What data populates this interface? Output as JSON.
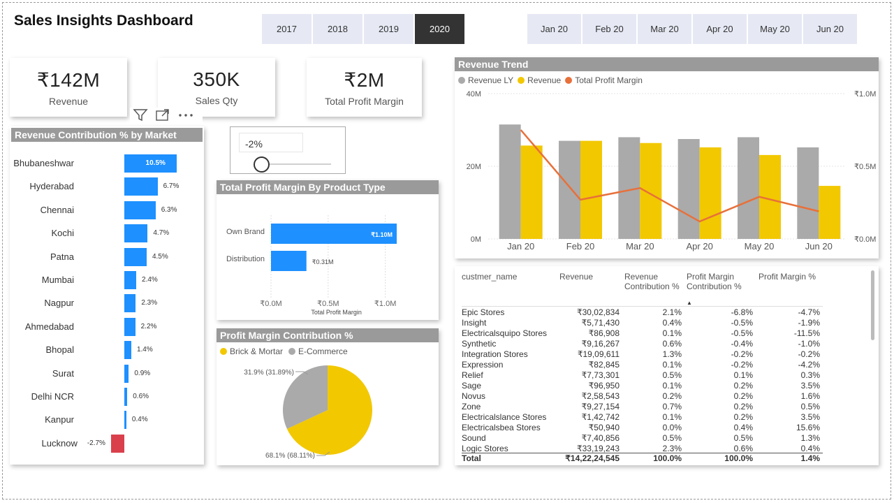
{
  "title": "Sales Insights Dashboard",
  "years": [
    {
      "label": "2017",
      "selected": false
    },
    {
      "label": "2018",
      "selected": false
    },
    {
      "label": "2019",
      "selected": false
    },
    {
      "label": "2020",
      "selected": true
    }
  ],
  "months": [
    {
      "label": "Jan 20"
    },
    {
      "label": "Feb 20"
    },
    {
      "label": "Mar 20"
    },
    {
      "label": "Apr 20"
    },
    {
      "label": "May 20"
    },
    {
      "label": "Jun 20"
    }
  ],
  "kpis": [
    {
      "value": "₹142M",
      "label": "Revenue"
    },
    {
      "value": "350K",
      "label": "Sales Qty"
    },
    {
      "value": "₹2M",
      "label": "Total Profit Margin"
    }
  ],
  "slider": {
    "value": "-2%"
  },
  "colors": {
    "blue": "#1e90ff",
    "red": "#d9404b",
    "gray": "#aaaaaa",
    "yellow": "#f2c800",
    "orange": "#e8703a",
    "dark": "#333333"
  },
  "visual_icons": [
    "filter-icon",
    "focus-mode-icon",
    "more-options-icon"
  ],
  "market_chart": {
    "title": "Revenue Contribution % by Market",
    "chart_data": {
      "type": "bar",
      "orientation": "horizontal",
      "categories": [
        "Bhubaneshwar",
        "Hyderabad",
        "Chennai",
        "Kochi",
        "Patna",
        "Mumbai",
        "Nagpur",
        "Ahmedabad",
        "Bhopal",
        "Surat",
        "Delhi NCR",
        "Kanpur",
        "Lucknow"
      ],
      "values": [
        10.5,
        6.7,
        6.3,
        4.7,
        4.5,
        2.4,
        2.3,
        2.2,
        1.4,
        0.9,
        0.6,
        0.4,
        -2.7
      ],
      "labels": [
        "10.5%",
        "6.7%",
        "6.3%",
        "4.7%",
        "4.5%",
        "2.4%",
        "2.3%",
        "2.2%",
        "1.4%",
        "0.9%",
        "0.6%",
        "0.4%",
        "-2.7%"
      ]
    }
  },
  "product_chart": {
    "title": "Total Profit Margin By Product Type",
    "chart_data": {
      "type": "bar",
      "orientation": "horizontal",
      "categories": [
        "Own Brand",
        "Distribution"
      ],
      "values": [
        1.1,
        0.31
      ],
      "labels": [
        "₹1.10M",
        "₹0.31M"
      ],
      "xticks": [
        "₹0.0M",
        "₹0.5M",
        "₹1.0M"
      ],
      "xlim": [
        0,
        1.1
      ],
      "xlabel": "Total Profit Margin"
    }
  },
  "pie_chart": {
    "title": "Profit Margin Contribution %",
    "legend": [
      {
        "name": "Brick & Mortar",
        "color": "#f2c800"
      },
      {
        "name": "E-Commerce",
        "color": "#aaaaaa"
      }
    ],
    "chart_data": {
      "type": "pie",
      "slices": [
        {
          "name": "Brick & Mortar",
          "value": 68.11,
          "label": "68.1% (68.11%)"
        },
        {
          "name": "E-Commerce",
          "value": 31.89,
          "label": "31.9% (31.89%)"
        }
      ]
    }
  },
  "trend_chart": {
    "title": "Revenue Trend",
    "legend": [
      {
        "name": "Revenue LY",
        "color": "#aaaaaa"
      },
      {
        "name": "Revenue",
        "color": "#f2c800"
      },
      {
        "name": "Total Profit Margin",
        "color": "#e8703a"
      }
    ],
    "chart_data": {
      "type": "bar",
      "categories": [
        "Jan 20",
        "Feb 20",
        "Mar 20",
        "Apr 20",
        "May 20",
        "Jun 20"
      ],
      "series": [
        {
          "name": "Revenue LY",
          "axis": "left",
          "values": [
            31.5,
            27,
            28,
            27.5,
            28,
            25.2
          ]
        },
        {
          "name": "Revenue",
          "axis": "left",
          "values": [
            25.7,
            27,
            26.4,
            25.2,
            23.1,
            14.6
          ]
        },
        {
          "name": "Total Profit Margin",
          "axis": "right",
          "type": "line",
          "values": [
            0.75,
            0.27,
            0.35,
            0.12,
            0.29,
            0.19
          ]
        }
      ],
      "yticks_left": [
        "0M",
        "20M",
        "40M"
      ],
      "ylim_left": [
        0,
        40
      ],
      "yticks_right": [
        "₹0.0M",
        "₹0.5M",
        "₹1.0M"
      ],
      "ylim_right": [
        0,
        1.0
      ]
    }
  },
  "table": {
    "headers": [
      "custmer_name",
      "Revenue",
      "Revenue Contribution %",
      "Profit Margin Contribution %",
      "Profit Margin %"
    ],
    "sort_indicator": "▲",
    "rows": [
      [
        "Epic Stores",
        "₹30,02,834",
        "2.1%",
        "-6.8%",
        "-4.7%"
      ],
      [
        "Insight",
        "₹5,71,430",
        "0.4%",
        "-0.5%",
        "-1.9%"
      ],
      [
        "Electricalsquipo Stores",
        "₹86,908",
        "0.1%",
        "-0.5%",
        "-11.5%"
      ],
      [
        "Synthetic",
        "₹9,16,267",
        "0.6%",
        "-0.4%",
        "-1.0%"
      ],
      [
        "Integration Stores",
        "₹19,09,611",
        "1.3%",
        "-0.2%",
        "-0.2%"
      ],
      [
        "Expression",
        "₹82,845",
        "0.1%",
        "-0.2%",
        "-4.2%"
      ],
      [
        "Relief",
        "₹7,73,301",
        "0.5%",
        "0.1%",
        "0.3%"
      ],
      [
        "Sage",
        "₹96,950",
        "0.1%",
        "0.2%",
        "3.5%"
      ],
      [
        "Novus",
        "₹2,58,543",
        "0.2%",
        "0.2%",
        "1.6%"
      ],
      [
        "Zone",
        "₹9,27,154",
        "0.7%",
        "0.2%",
        "0.5%"
      ],
      [
        "Electricalslance Stores",
        "₹1,42,742",
        "0.1%",
        "0.2%",
        "3.5%"
      ],
      [
        "Electricalsbea Stores",
        "₹50,940",
        "0.0%",
        "0.4%",
        "15.6%"
      ],
      [
        "Sound",
        "₹7,40,856",
        "0.5%",
        "0.5%",
        "1.3%"
      ],
      [
        "Logic Stores",
        "₹33,19,243",
        "2.3%",
        "0.6%",
        "0.4%"
      ]
    ],
    "total": [
      "Total",
      "₹14,22,24,545",
      "100.0%",
      "100.0%",
      "1.4%"
    ]
  }
}
